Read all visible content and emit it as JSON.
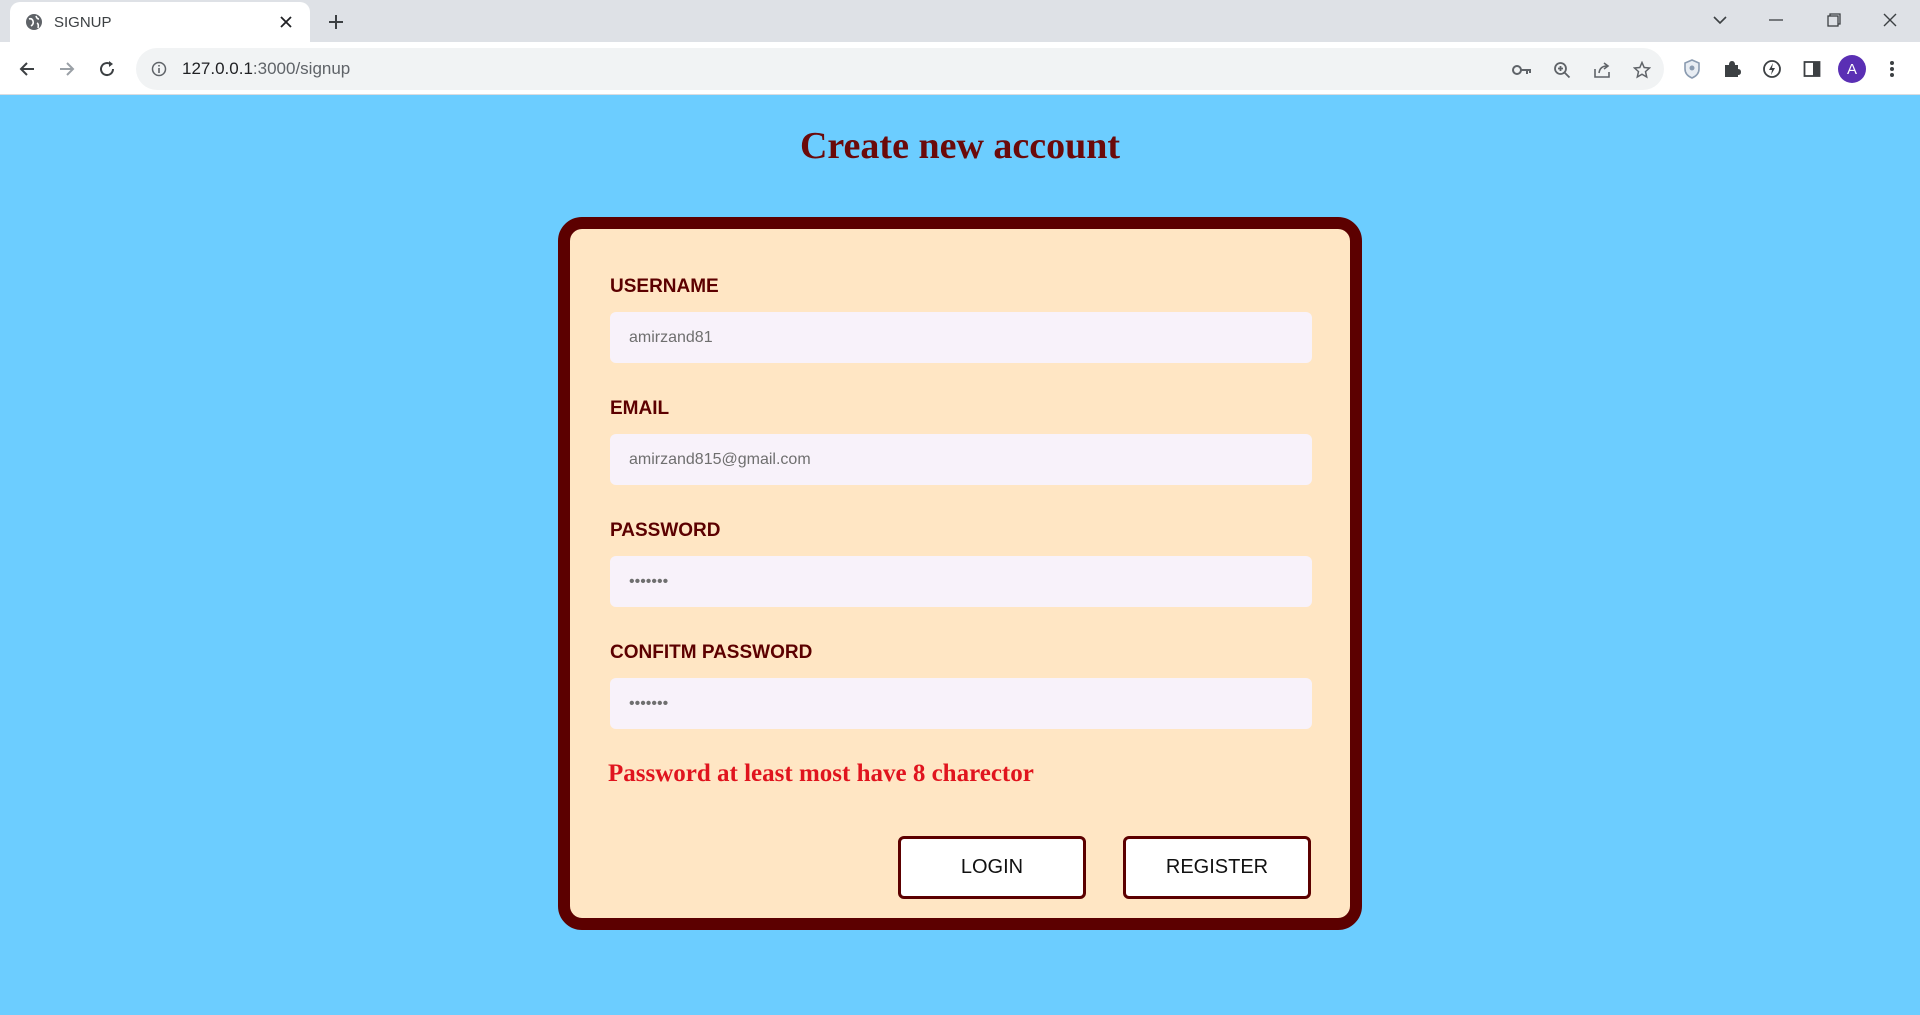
{
  "browser": {
    "tab_title": "SIGNUP",
    "url_host": "127.0.0.1",
    "url_path": ":3000/signup",
    "profile_initial": "A"
  },
  "page": {
    "title": "Create new account",
    "fields": [
      {
        "label": "USERNAME",
        "value": "amirzand81",
        "type": "text"
      },
      {
        "label": "EMAIL",
        "value": "amirzand815@gmail.com",
        "type": "text"
      },
      {
        "label": "PASSWORD",
        "value": "1234567",
        "type": "password"
      },
      {
        "label": "CONFITM PASSWORD",
        "value": "1234567",
        "type": "password"
      }
    ],
    "error_message": "Password at least most have 8 charector",
    "login_label": "LOGIN",
    "register_label": "REGISTER"
  },
  "colors": {
    "background": "#6ccdff",
    "card_background": "#ffe6c4",
    "card_border": "#5c0000",
    "title": "#6b0a0a",
    "error": "#e0141e"
  }
}
